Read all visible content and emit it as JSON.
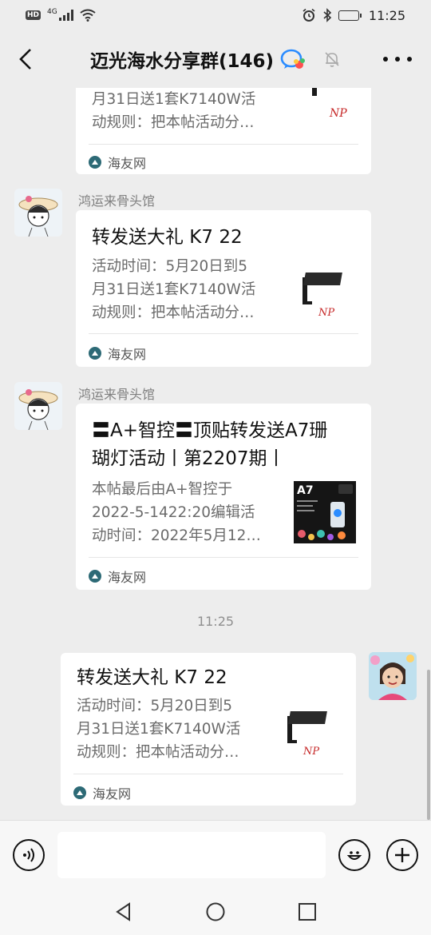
{
  "status_bar": {
    "hd": "HD",
    "network": "4G",
    "time": "11:25"
  },
  "header": {
    "title": "迈光海水分享群(146)"
  },
  "messages": [
    {
      "sender": "",
      "title_line": "",
      "desc": "月31日送1套K7140W活动规则：把本帖活动分…",
      "source": "海友网"
    },
    {
      "sender": "鸿运来骨头馆",
      "title": "转发送大礼 K7 22",
      "desc": "活动时间：5月20日到5月31日送1套K7140W活动规则：把本帖活动分…",
      "source": "海友网"
    },
    {
      "sender": "鸿运来骨头馆",
      "title": "〓A+智控〓顶贴转发送A7珊瑚灯活动丨第2207期丨",
      "desc": "本帖最后由A+智控于2022-5-1422:20编辑活动时间：2022年5月12…",
      "source": "海友网"
    },
    {
      "sender": "",
      "title": "转发送大礼 K7 22",
      "desc": "活动时间：5月20日到5月31日送1套K7140W活动规则：把本帖活动分…",
      "source": "海友网"
    }
  ],
  "texts": {
    "c1_desc_l1": "月31日送1套K7140W活",
    "c1_desc_l2": "动规则：把本帖活动分…",
    "c2_title": "转发送大礼 K7 22",
    "c2_desc_l1": "活动时间：5月20日到5",
    "c2_desc_l2": "月31日送1套K7140W活",
    "c2_desc_l3": "动规则：把本帖活动分…",
    "c3_title_l1": "〓A+智控〓顶贴转发送A7珊",
    "c3_title_l2": "瑚灯活动丨第2207期丨",
    "c3_desc_l1": "本帖最后由A+智控于",
    "c3_desc_l2": "2022-5-1422:20编辑活",
    "c3_desc_l3": "动时间：2022年5月12…",
    "c4_title": "转发送大礼 K7 22",
    "c4_desc_l1": "活动时间：5月20日到5",
    "c4_desc_l2": "月31日送1套K7140W活",
    "c4_desc_l3": "动规则：把本帖活动分…",
    "sender_name": "鸿运来骨头馆",
    "source_name": "海友网",
    "thumb_brand": "NP",
    "thumb_a7": "A7"
  },
  "timestamp": "11:25",
  "input": {
    "placeholder": ""
  },
  "icons": {
    "back": "chevron-left-icon",
    "group_chat": "group-chat-icon",
    "mute": "bell-off-icon",
    "more": "more-dots-icon",
    "voice": "voice-icon",
    "emoji": "emoji-icon",
    "add": "plus-icon"
  },
  "colors": {
    "background": "#ededed",
    "card": "#ffffff",
    "accent_blue": "#2b8cff",
    "source_logo": "#2d6a76"
  }
}
